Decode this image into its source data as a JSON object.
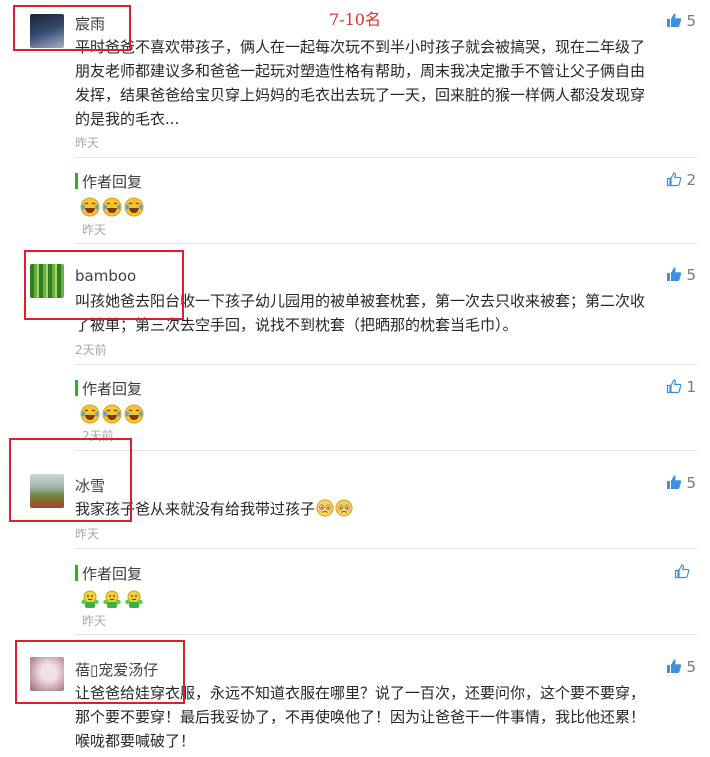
{
  "banner": "7-10名",
  "comments": [
    {
      "name": "宸雨",
      "likes": "5",
      "lines": [
        "平时爸爸不喜欢带孩子，俩人在一起每次玩不到半小时孩子就会被搞哭，现在二年级了",
        "朋友老师都建议多和爸爸一起玩对塑造性格有帮助，周末我决定撒手不管让父子俩自由",
        "发挥，结果爸爸给宝贝穿上妈妈的毛衣出去玩了一天，回来脏的猴一样俩人都没发现穿",
        "的是我的毛衣..."
      ],
      "time": "昨天",
      "reply": {
        "label": "作者回复",
        "likes": "2",
        "time": "昨天",
        "emoji": "laugh-cry-emoji"
      }
    },
    {
      "name": "bamboo",
      "likes": "5",
      "lines": [
        "叫孩她爸去阳台收一下孩子幼儿园用的被单被套枕套，第一次去只收来被套；第二次收",
        "了被单；第三次去空手回，说找不到枕套（把晒那的枕套当毛巾）。"
      ],
      "time": "2天前",
      "reply": {
        "label": "作者回复",
        "likes": "1",
        "time": "2天前",
        "emoji": "laugh-cry-emoji"
      }
    },
    {
      "name": "冰雪",
      "likes": "5",
      "lines": [
        "我家孩子爸从来就没有给我带过孩子"
      ],
      "time": "昨天",
      "reply": {
        "label": "作者回复",
        "likes": "",
        "time": "昨天",
        "emoji": "green-fist-emoji"
      }
    },
    {
      "name": "蓓▯宠爱汤仔",
      "likes": "5",
      "lines": [
        "让爸爸给娃穿衣服，永远不知道衣服在哪里？说了一百次，还要问你，这个要不要穿，",
        "那个要不要穿！最后我妥协了，不再使唤他了！因为让爸爸干一件事情，我比他还累！",
        "喉咙都要喊破了！"
      ],
      "time": ""
    }
  ]
}
